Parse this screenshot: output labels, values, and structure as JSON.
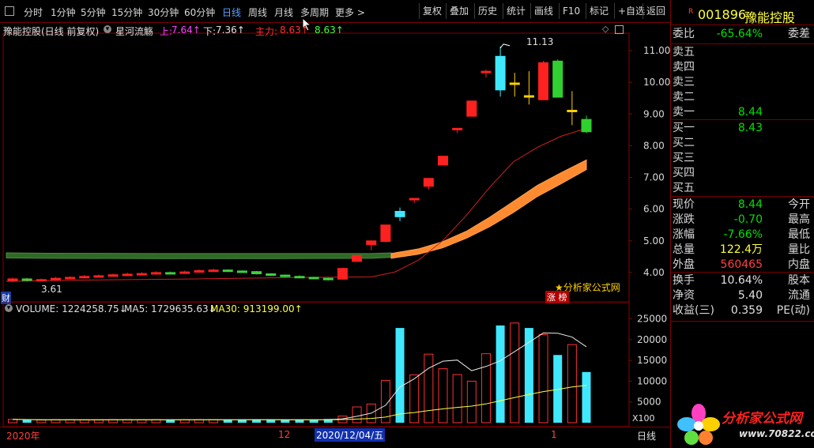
{
  "toolbar": {
    "left_items": [
      "分时",
      "1分钟",
      "5分钟",
      "15分钟",
      "30分钟",
      "60分钟",
      "日线",
      "周线",
      "月线",
      "多周期",
      "更多 >"
    ],
    "active_item": "日线",
    "right_items": [
      "复权",
      "叠加",
      "历史",
      "统计",
      "画线",
      "F10",
      "标记",
      "+自选",
      "返回"
    ]
  },
  "main_header": {
    "stock_title": "豫能控股(日线 前复权)",
    "indicator_name": "星河流觞",
    "up_label": "上:",
    "up_value": "7.64↑",
    "down_label": "下:",
    "down_value": "7.36↑",
    "main_label": "主力:",
    "main_value": "8.63↑",
    "main_value2": "8.63↑"
  },
  "annotations": {
    "high_marker": "11.13",
    "low_marker": "3.61",
    "cai_badge": "财",
    "watermark": "★分析家公式网",
    "zhangting": "涨 榜"
  },
  "price_axis": [
    "11.00",
    "10.00",
    "9.00",
    "8.00",
    "7.00",
    "6.00",
    "5.00",
    "4.00"
  ],
  "vol_header": {
    "volume": "VOLUME: 1224258.75↓",
    "ma5": "MA5: 1729635.63↓",
    "ma30": "MA30: 913199.00↑"
  },
  "vol_axis": [
    "25000",
    "20000",
    "15000",
    "10000",
    "5000"
  ],
  "vol_unit": "X100",
  "date_bar": {
    "year": "2020年",
    "month": "12",
    "cursor_date": "2020/12/04/五",
    "next_month": "1",
    "period": "日线"
  },
  "panel": {
    "code": "001896",
    "name": "豫能控股",
    "r_badge": "R",
    "weibi_label": "委比",
    "weibi_value": "-65.64%",
    "weicha_label": "委差",
    "sell": [
      {
        "label": "卖五",
        "price": ""
      },
      {
        "label": "卖四",
        "price": ""
      },
      {
        "label": "卖三",
        "price": ""
      },
      {
        "label": "卖二",
        "price": ""
      },
      {
        "label": "卖一",
        "price": "8.44"
      }
    ],
    "buy": [
      {
        "label": "买一",
        "price": "8.43"
      },
      {
        "label": "买二",
        "price": ""
      },
      {
        "label": "买三",
        "price": ""
      },
      {
        "label": "买四",
        "price": ""
      },
      {
        "label": "买五",
        "price": ""
      }
    ],
    "stats": [
      {
        "label": "现价",
        "value": "8.44",
        "label2": "今开",
        "color": "#00e000"
      },
      {
        "label": "涨跌",
        "value": "-0.70",
        "label2": "最高",
        "color": "#00e000"
      },
      {
        "label": "涨幅",
        "value": "-7.66%",
        "label2": "最低",
        "color": "#00e000"
      },
      {
        "label": "总量",
        "value": "122.4万",
        "label2": "量比",
        "color": "#ffff40"
      },
      {
        "label": "外盘",
        "value": "560465",
        "label2": "内盘",
        "color": "#ff4040"
      }
    ],
    "stats2": [
      {
        "label": "换手",
        "value": "10.64%",
        "label2": "股本",
        "color": "#e0e0e0"
      },
      {
        "label": "净资",
        "value": "5.40",
        "label2": "流通",
        "color": "#e0e0e0"
      },
      {
        "label": "收益(三)",
        "value": "0.359",
        "label2": "PE(动)",
        "color": "#e0e0e0"
      }
    ],
    "logo_text": "分析家公式网",
    "logo_url": "www.70822.com"
  },
  "chart_data": {
    "type": "candlestick",
    "price_range": [
      3.4,
      11.5
    ],
    "candles": [
      {
        "o": 3.74,
        "c": 3.8,
        "h": 3.84,
        "l": 3.7
      },
      {
        "o": 3.8,
        "c": 3.76,
        "h": 3.83,
        "l": 3.72
      },
      {
        "o": 3.76,
        "c": 3.78,
        "h": 3.81,
        "l": 3.73
      },
      {
        "o": 3.78,
        "c": 3.82,
        "h": 3.86,
        "l": 3.75
      },
      {
        "o": 3.82,
        "c": 3.85,
        "h": 3.88,
        "l": 3.79
      },
      {
        "o": 3.85,
        "c": 3.88,
        "h": 3.92,
        "l": 3.82
      },
      {
        "o": 3.88,
        "c": 3.9,
        "h": 3.94,
        "l": 3.85
      },
      {
        "o": 3.9,
        "c": 3.93,
        "h": 3.96,
        "l": 3.87
      },
      {
        "o": 3.93,
        "c": 3.95,
        "h": 3.99,
        "l": 3.9
      },
      {
        "o": 3.95,
        "c": 3.97,
        "h": 4.01,
        "l": 3.92
      },
      {
        "o": 3.97,
        "c": 4.0,
        "h": 4.04,
        "l": 3.94
      },
      {
        "o": 4.0,
        "c": 3.98,
        "h": 4.03,
        "l": 3.95
      },
      {
        "o": 3.98,
        "c": 4.02,
        "h": 4.06,
        "l": 3.96
      },
      {
        "o": 4.02,
        "c": 4.06,
        "h": 4.1,
        "l": 3.99
      },
      {
        "o": 4.06,
        "c": 4.08,
        "h": 4.12,
        "l": 4.03
      },
      {
        "o": 4.08,
        "c": 4.05,
        "h": 4.1,
        "l": 4.02
      },
      {
        "o": 4.05,
        "c": 4.03,
        "h": 4.07,
        "l": 4.0
      },
      {
        "o": 4.03,
        "c": 3.96,
        "h": 4.05,
        "l": 3.94
      },
      {
        "o": 3.96,
        "c": 3.92,
        "h": 3.98,
        "l": 3.89
      },
      {
        "o": 3.92,
        "c": 3.88,
        "h": 3.94,
        "l": 3.85
      },
      {
        "o": 3.88,
        "c": 3.85,
        "h": 3.91,
        "l": 3.82
      },
      {
        "o": 3.85,
        "c": 3.82,
        "h": 3.87,
        "l": 3.8
      },
      {
        "o": 3.82,
        "c": 3.78,
        "h": 3.84,
        "l": 3.75
      },
      {
        "o": 3.79,
        "c": 4.13,
        "h": 4.15,
        "l": 3.78
      },
      {
        "o": 4.35,
        "c": 4.54,
        "h": 4.55,
        "l": 4.34
      },
      {
        "o": 4.88,
        "c": 5.0,
        "h": 5.0,
        "l": 4.7
      },
      {
        "o": 4.98,
        "c": 5.5,
        "h": 5.5,
        "l": 4.95
      },
      {
        "o": 5.93,
        "c": 5.76,
        "h": 6.05,
        "l": 5.62
      },
      {
        "o": 6.3,
        "c": 6.34,
        "h": 6.34,
        "l": 6.2
      },
      {
        "o": 6.72,
        "c": 6.97,
        "h": 6.97,
        "l": 6.62
      },
      {
        "o": 7.39,
        "c": 7.67,
        "h": 7.67,
        "l": 7.39
      },
      {
        "o": 8.55,
        "c": 8.55,
        "h": 8.55,
        "l": 8.4
      },
      {
        "o": 8.93,
        "c": 9.41,
        "h": 9.41,
        "l": 8.93
      },
      {
        "o": 10.32,
        "c": 10.35,
        "h": 10.4,
        "l": 10.15
      },
      {
        "o": 10.82,
        "c": 9.76,
        "h": 11.13,
        "l": 9.55
      },
      {
        "o": 9.95,
        "c": 9.98,
        "h": 10.3,
        "l": 9.55
      },
      {
        "o": 9.58,
        "c": 9.55,
        "h": 10.35,
        "l": 9.3
      },
      {
        "o": 9.45,
        "c": 10.62,
        "h": 10.68,
        "l": 9.45
      },
      {
        "o": 10.67,
        "c": 9.53,
        "h": 10.72,
        "l": 9.53
      },
      {
        "o": 9.08,
        "c": 9.12,
        "h": 9.72,
        "l": 8.65
      },
      {
        "o": 8.83,
        "c": 8.44,
        "h": 8.95,
        "l": 8.4
      }
    ],
    "volume_range": [
      0,
      27000
    ],
    "volume": [
      800,
      700,
      650,
      700,
      720,
      680,
      700,
      750,
      720,
      700,
      740,
      690,
      700,
      720,
      760,
      700,
      690,
      800,
      700,
      720,
      680,
      700,
      900,
      1600,
      3800,
      4500,
      10200,
      22800,
      11500,
      16500,
      13000,
      11600,
      10000,
      16600,
      23400,
      24000,
      22800,
      21200,
      16300,
      18800,
      12200
    ]
  }
}
